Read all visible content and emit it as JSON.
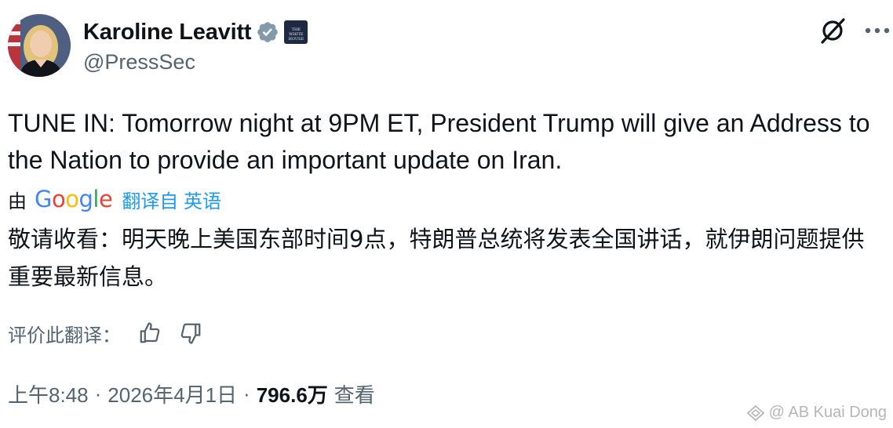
{
  "author": {
    "display_name": "Karoline Leavitt",
    "handle": "@PressSec",
    "affiliation_badge_text": "THE WHITE HOUSE",
    "verified_color": "#829aab"
  },
  "actions": {
    "grok_icon": "grok-icon",
    "more_icon": "more-options-icon"
  },
  "tweet": {
    "text": "TUNE IN: Tomorrow night at 9PM ET, President Trump will give an Address to the Nation to provide an important update on Iran."
  },
  "translation": {
    "prefix": "由",
    "provider_letters": [
      "G",
      "o",
      "o",
      "g",
      "l",
      "e"
    ],
    "link_label": "翻译自 英语",
    "translated_text": "敬请收看：明天晚上美国东部时间9点，特朗普总统将发表全国讲话，就伊朗问题提供重要最新信息。",
    "rate_label": "评价此翻译：",
    "google_colors": [
      "#4285F4",
      "#EA4335",
      "#FBBC05",
      "#4285F4",
      "#34A853",
      "#EA4335"
    ]
  },
  "meta": {
    "time": "上午8:48",
    "separator": "·",
    "date": "2026年4月1日",
    "views_count": "796.6万",
    "views_label": "查看"
  },
  "watermark": {
    "text": "@ AB Kuai Dong"
  },
  "colors": {
    "text_primary": "#0f1419",
    "text_secondary": "#536471",
    "link": "#1d9bf0"
  }
}
